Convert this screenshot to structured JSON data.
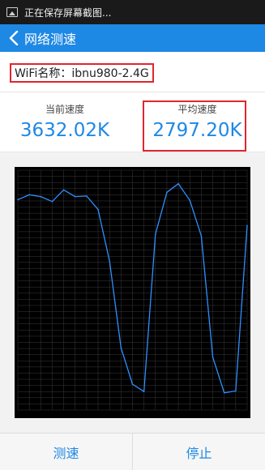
{
  "statusbar": {
    "icon": "image-icon",
    "text": "正在保存屏幕截图..."
  },
  "header": {
    "back_icon": "chevron-left-icon",
    "title": "网络测速"
  },
  "wifi": {
    "label": "WiFi名称：ibnu980-2.4G"
  },
  "speeds": {
    "current_label": "当前速度",
    "current_value": "3632.02K",
    "average_label": "平均速度",
    "average_value": "2797.20K"
  },
  "chart_data": {
    "type": "line",
    "title": "",
    "xlabel": "",
    "ylabel": "",
    "x": [
      0,
      5,
      10,
      15,
      20,
      25,
      30,
      35,
      40,
      45,
      50,
      55,
      60,
      65,
      70,
      75,
      80,
      85,
      90,
      95,
      100
    ],
    "series": [
      {
        "values": [
          3420,
          3500,
          3470,
          3390,
          3580,
          3470,
          3480,
          3260,
          2420,
          1010,
          420,
          300,
          2860,
          3540,
          3680,
          3410,
          2830,
          860,
          280,
          310,
          3000
        ]
      }
    ],
    "ylim": [
      0,
      3900
    ],
    "xlim": [
      0,
      100
    ],
    "grid": true,
    "colors": {
      "background": "#000000",
      "grid": "#3a3a3a",
      "line": "#2f8fff",
      "tick": "#cccccc"
    }
  },
  "footer": {
    "test_label": "测速",
    "stop_label": "停止"
  },
  "colors": {
    "accent": "#1e88e5",
    "highlight_border": "#e0262f"
  }
}
